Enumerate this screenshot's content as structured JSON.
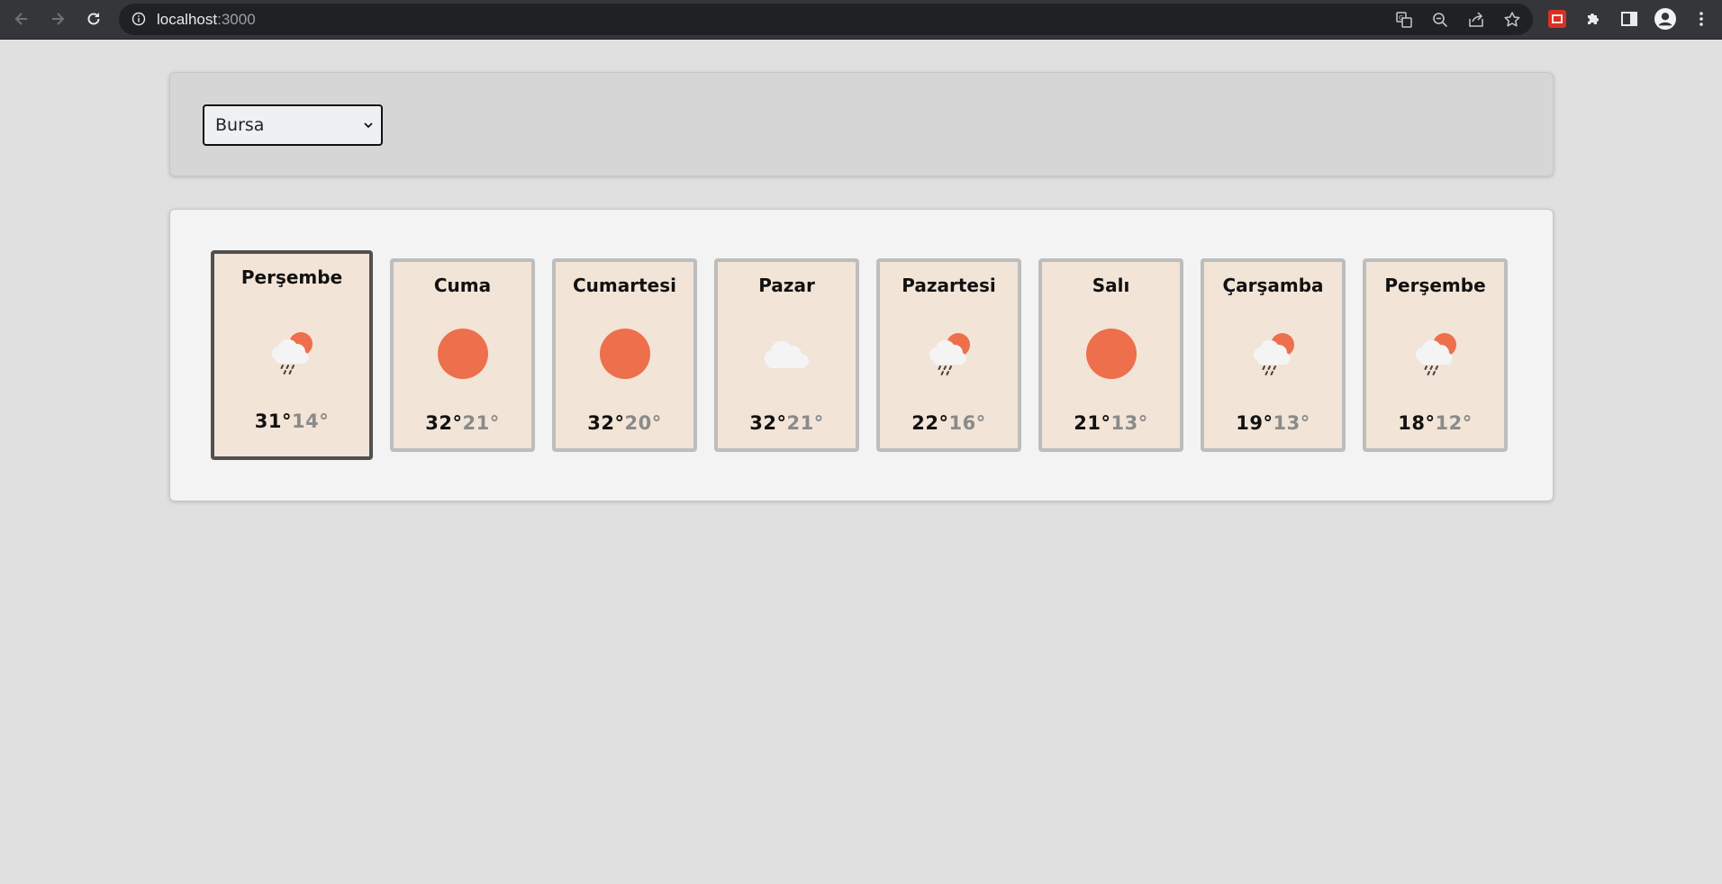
{
  "browser": {
    "url_host": "localhost",
    "url_port": ":3000"
  },
  "city_select": {
    "selected": "Bursa"
  },
  "colors": {
    "sun": "#ed6f4b",
    "card_bg": "#f2e4d6",
    "selected_border": "#505050"
  },
  "forecast": [
    {
      "day": "Perşembe",
      "icon": "rain-sun-icon",
      "high": "31°",
      "low": "14°"
    },
    {
      "day": "Cuma",
      "icon": "sun-icon",
      "high": "32°",
      "low": "21°"
    },
    {
      "day": "Cumartesi",
      "icon": "sun-icon",
      "high": "32°",
      "low": "20°"
    },
    {
      "day": "Pazar",
      "icon": "cloud-icon",
      "high": "32°",
      "low": "21°"
    },
    {
      "day": "Pazartesi",
      "icon": "rain-sun-icon",
      "high": "22°",
      "low": "16°"
    },
    {
      "day": "Salı",
      "icon": "sun-icon",
      "high": "21°",
      "low": "13°"
    },
    {
      "day": "Çarşamba",
      "icon": "rain-sun-icon",
      "high": "19°",
      "low": "13°"
    },
    {
      "day": "Perşembe",
      "icon": "rain-sun-icon",
      "high": "18°",
      "low": "12°"
    }
  ]
}
